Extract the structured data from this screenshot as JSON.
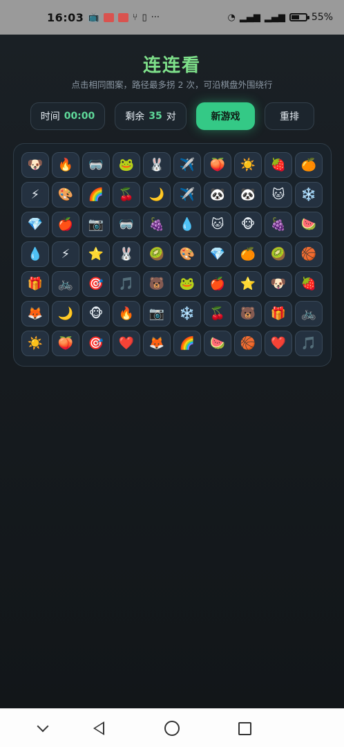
{
  "status_bar": {
    "time": "16:03",
    "more": "···",
    "battery": "55%",
    "battery_level": 0.55
  },
  "game": {
    "title": "连连看",
    "subtitle": "点击相同图案，路径最多拐 2 次，可沿棋盘外围绕行",
    "time_label": "时间",
    "time_value": "00:00",
    "remaining_label": "剩余",
    "remaining_value": "35",
    "remaining_unit": "对",
    "new_game_label": "新游戏",
    "shuffle_label": "重排",
    "board": [
      [
        "🐶",
        "🔥",
        "🥽",
        "🐸",
        "🐰",
        "✈️",
        "🍑",
        "☀️",
        "🍓",
        "🍊"
      ],
      [
        "⚡",
        "🎨",
        "🌈",
        "🍒",
        "🌙",
        "✈️",
        "🐼",
        "🐼",
        "🐱",
        "❄️"
      ],
      [
        "💎",
        "🍎",
        "📷",
        "🥽",
        "🍇",
        "💧",
        "🐱",
        "🐵",
        "🍇",
        "🍉"
      ],
      [
        "💧",
        "⚡",
        "⭐",
        "🐰",
        "🥝",
        "🎨",
        "💎",
        "🍊",
        "🥝",
        "🏀"
      ],
      [
        "🎁",
        "🚲",
        "🎯",
        "🎵",
        "🐻",
        "🐸",
        "🍎",
        "⭐",
        "🐶",
        "🍓"
      ],
      [
        "🦊",
        "🌙",
        "🐵",
        "🔥",
        "📷",
        "❄️",
        "🍒",
        "🐻",
        "🎁",
        "🚲"
      ],
      [
        "☀️",
        "🍑",
        "🎯",
        "❤️",
        "🦊",
        "🌈",
        "🍉",
        "🏀",
        "❤️",
        "🎵"
      ]
    ]
  },
  "colors": {
    "accent": "#34c986",
    "title": "#7ee08a",
    "background": "#15191d"
  }
}
